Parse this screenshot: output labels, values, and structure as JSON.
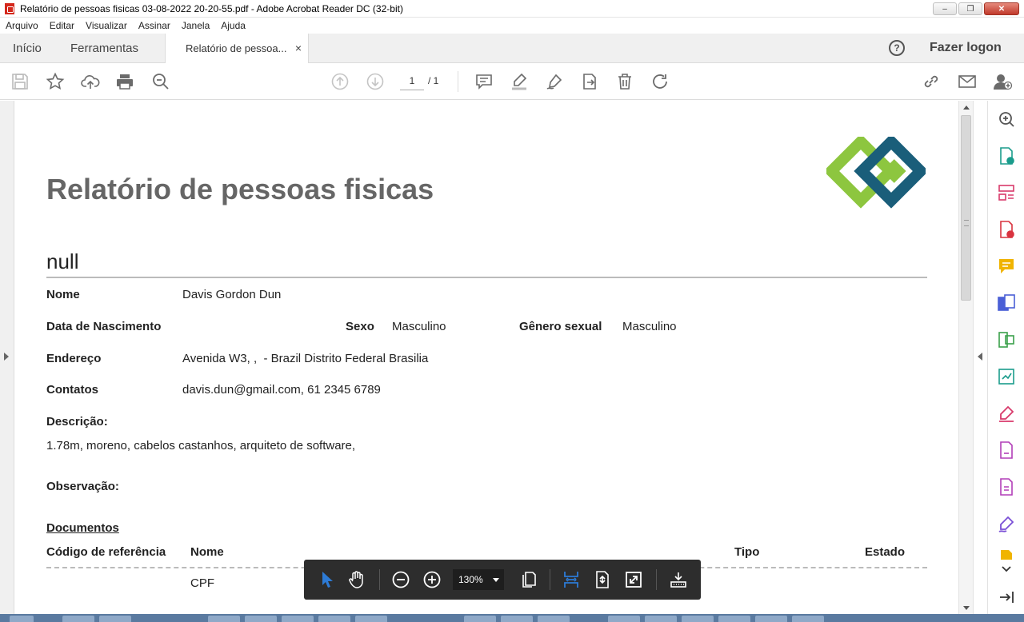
{
  "window": {
    "title": "Relatório de pessoas fisicas 03-08-2022 20-20-55.pdf - Adobe Acrobat Reader DC (32-bit)",
    "app_icon": "acrobat-icon",
    "controls": [
      "minimize-icon",
      "restore-icon",
      "close-icon"
    ]
  },
  "menu": {
    "items": [
      "Arquivo",
      "Editar",
      "Visualizar",
      "Assinar",
      "Janela",
      "Ajuda"
    ]
  },
  "tabs": {
    "home": "Início",
    "tools": "Ferramentas",
    "document": "Relatório de pessoa...",
    "document_close": "×",
    "help": "?",
    "login": "Fazer logon"
  },
  "toolbar": {
    "left_icons": [
      "save-icon",
      "star-icon",
      "upload-icon",
      "print-icon",
      "search-icon"
    ],
    "nav_icons": [
      "prev-page-icon",
      "next-page-icon"
    ],
    "current_page": "1",
    "page_total": "/ 1",
    "edit_icons": [
      "comment-icon",
      "highlight-icon",
      "sign-icon",
      "send-icon",
      "delete-icon",
      "rotate-icon"
    ],
    "right_icons": [
      "link-icon",
      "mail-icon",
      "add-user-icon"
    ]
  },
  "document": {
    "report_title": "Relatório de pessoas fisicas",
    "person_header": "null",
    "fields": {
      "nome_label": "Nome",
      "nome_value": "Davis Gordon Dun",
      "nascimento_label": "Data de Nascimento",
      "sexo_label": "Sexo",
      "sexo_value": "Masculino",
      "genero_label": "Gênero sexual",
      "genero_value": "Masculino",
      "endereco_label": "Endereço",
      "endereco_value": "Avenida W3, ,  - Brazil Distrito Federal Brasilia",
      "contatos_label": "Contatos",
      "contatos_value": "davis.dun@gmail.com, 61 2345 6789",
      "descricao_label": "Descrição:",
      "descricao_value": "1.78m, moreno, cabelos castanhos, arquiteto de software,",
      "observacao_label": "Observação:"
    },
    "documents_section": {
      "title": "Documentos",
      "columns": [
        "Código de referência",
        "Nome",
        "Tipo",
        "Estado"
      ],
      "rows": [
        {
          "codigo": "",
          "nome": "CPF",
          "tipo": "",
          "estado": ""
        }
      ]
    },
    "logo": "company-logo",
    "logo_colors": [
      "#8dc63f",
      "#1a5e7a"
    ]
  },
  "float_toolbar": {
    "zoom": "130%",
    "icons": [
      "select-cursor-icon",
      "hand-icon",
      "zoom-out-icon",
      "zoom-in-icon",
      "page-view-icon",
      "fit-width-icon",
      "fit-page-icon",
      "fullscreen-icon",
      "read-mode-icon"
    ]
  },
  "right_pane": {
    "icons": [
      "zoom-tool-icon",
      "export-pdf-icon",
      "organize-pages-icon",
      "create-pdf-icon",
      "comment-tool-icon",
      "combine-files-icon",
      "compress-icon",
      "convert-icon",
      "fill-sign-icon",
      "edit-pdf-icon",
      "protect-icon",
      "signature-icon",
      "more-tools-icon"
    ],
    "expand": "chevron-down-icon",
    "collapse": "collapse-pane-icon"
  },
  "colors": {
    "accent_blue": "#2d7bd6",
    "toolbar_gray": "#6b6b6b",
    "title_gray": "#666666"
  }
}
